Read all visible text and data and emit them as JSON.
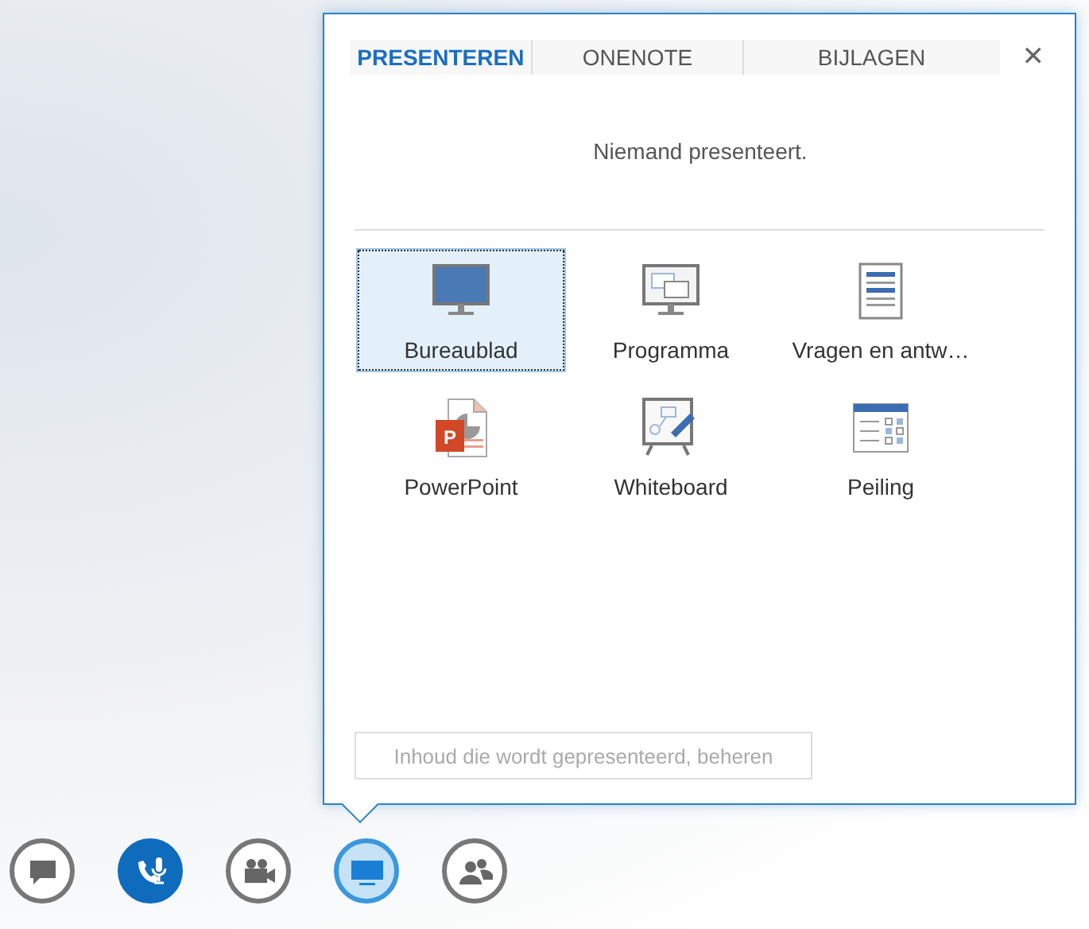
{
  "popup": {
    "tabs": [
      {
        "label": "PRESENTEREN",
        "selected": true
      },
      {
        "label": "ONENOTE",
        "selected": false
      },
      {
        "label": "BIJLAGEN",
        "selected": false
      }
    ],
    "close": "✕",
    "message": "Niemand presenteert.",
    "options": [
      {
        "kind": "desktop",
        "label": "Bureaublad",
        "selected": true
      },
      {
        "kind": "program",
        "label": "Programma",
        "selected": false
      },
      {
        "kind": "qa",
        "label": "Vragen en antw…",
        "selected": false
      },
      {
        "kind": "powerpoint",
        "label": "PowerPoint",
        "icon_letter": "P",
        "selected": false
      },
      {
        "kind": "whiteboard",
        "label": "Whiteboard",
        "selected": false
      },
      {
        "kind": "poll",
        "label": "Peiling",
        "selected": false
      }
    ],
    "manage_button": {
      "label": "Inhoud die wordt gepresenteerd, beheren",
      "disabled": true
    }
  },
  "toolbar": [
    {
      "kind": "chat",
      "active": false,
      "selected": false
    },
    {
      "kind": "call",
      "active": true,
      "selected": false
    },
    {
      "kind": "video",
      "active": false,
      "selected": false
    },
    {
      "kind": "present",
      "active": false,
      "selected": true
    },
    {
      "kind": "people",
      "active": false,
      "selected": false
    }
  ]
}
